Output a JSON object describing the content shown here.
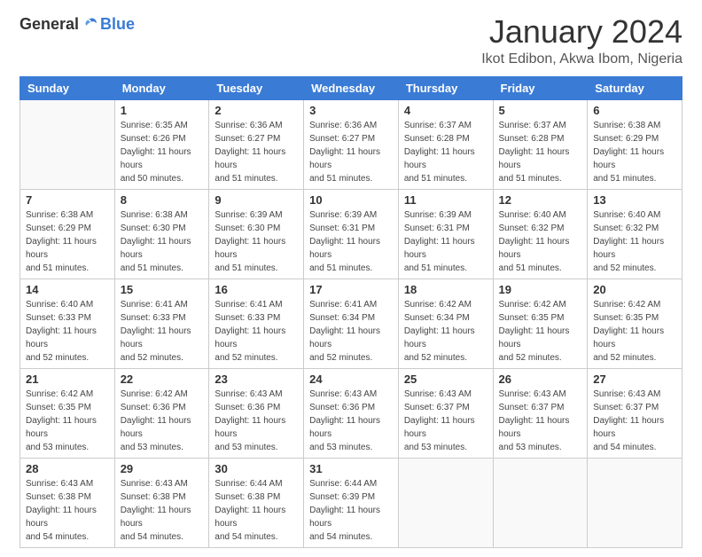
{
  "header": {
    "logo_general": "General",
    "logo_blue": "Blue",
    "month_title": "January 2024",
    "location": "Ikot Edibon, Akwa Ibom, Nigeria"
  },
  "weekdays": [
    "Sunday",
    "Monday",
    "Tuesday",
    "Wednesday",
    "Thursday",
    "Friday",
    "Saturday"
  ],
  "weeks": [
    [
      {
        "day": "",
        "sunrise": "",
        "sunset": "",
        "daylight": ""
      },
      {
        "day": "1",
        "sunrise": "Sunrise: 6:35 AM",
        "sunset": "Sunset: 6:26 PM",
        "daylight": "Daylight: 11 hours and 50 minutes."
      },
      {
        "day": "2",
        "sunrise": "Sunrise: 6:36 AM",
        "sunset": "Sunset: 6:27 PM",
        "daylight": "Daylight: 11 hours and 51 minutes."
      },
      {
        "day": "3",
        "sunrise": "Sunrise: 6:36 AM",
        "sunset": "Sunset: 6:27 PM",
        "daylight": "Daylight: 11 hours and 51 minutes."
      },
      {
        "day": "4",
        "sunrise": "Sunrise: 6:37 AM",
        "sunset": "Sunset: 6:28 PM",
        "daylight": "Daylight: 11 hours and 51 minutes."
      },
      {
        "day": "5",
        "sunrise": "Sunrise: 6:37 AM",
        "sunset": "Sunset: 6:28 PM",
        "daylight": "Daylight: 11 hours and 51 minutes."
      },
      {
        "day": "6",
        "sunrise": "Sunrise: 6:38 AM",
        "sunset": "Sunset: 6:29 PM",
        "daylight": "Daylight: 11 hours and 51 minutes."
      }
    ],
    [
      {
        "day": "7",
        "sunrise": "Sunrise: 6:38 AM",
        "sunset": "Sunset: 6:29 PM",
        "daylight": "Daylight: 11 hours and 51 minutes."
      },
      {
        "day": "8",
        "sunrise": "Sunrise: 6:38 AM",
        "sunset": "Sunset: 6:30 PM",
        "daylight": "Daylight: 11 hours and 51 minutes."
      },
      {
        "day": "9",
        "sunrise": "Sunrise: 6:39 AM",
        "sunset": "Sunset: 6:30 PM",
        "daylight": "Daylight: 11 hours and 51 minutes."
      },
      {
        "day": "10",
        "sunrise": "Sunrise: 6:39 AM",
        "sunset": "Sunset: 6:31 PM",
        "daylight": "Daylight: 11 hours and 51 minutes."
      },
      {
        "day": "11",
        "sunrise": "Sunrise: 6:39 AM",
        "sunset": "Sunset: 6:31 PM",
        "daylight": "Daylight: 11 hours and 51 minutes."
      },
      {
        "day": "12",
        "sunrise": "Sunrise: 6:40 AM",
        "sunset": "Sunset: 6:32 PM",
        "daylight": "Daylight: 11 hours and 51 minutes."
      },
      {
        "day": "13",
        "sunrise": "Sunrise: 6:40 AM",
        "sunset": "Sunset: 6:32 PM",
        "daylight": "Daylight: 11 hours and 52 minutes."
      }
    ],
    [
      {
        "day": "14",
        "sunrise": "Sunrise: 6:40 AM",
        "sunset": "Sunset: 6:33 PM",
        "daylight": "Daylight: 11 hours and 52 minutes."
      },
      {
        "day": "15",
        "sunrise": "Sunrise: 6:41 AM",
        "sunset": "Sunset: 6:33 PM",
        "daylight": "Daylight: 11 hours and 52 minutes."
      },
      {
        "day": "16",
        "sunrise": "Sunrise: 6:41 AM",
        "sunset": "Sunset: 6:33 PM",
        "daylight": "Daylight: 11 hours and 52 minutes."
      },
      {
        "day": "17",
        "sunrise": "Sunrise: 6:41 AM",
        "sunset": "Sunset: 6:34 PM",
        "daylight": "Daylight: 11 hours and 52 minutes."
      },
      {
        "day": "18",
        "sunrise": "Sunrise: 6:42 AM",
        "sunset": "Sunset: 6:34 PM",
        "daylight": "Daylight: 11 hours and 52 minutes."
      },
      {
        "day": "19",
        "sunrise": "Sunrise: 6:42 AM",
        "sunset": "Sunset: 6:35 PM",
        "daylight": "Daylight: 11 hours and 52 minutes."
      },
      {
        "day": "20",
        "sunrise": "Sunrise: 6:42 AM",
        "sunset": "Sunset: 6:35 PM",
        "daylight": "Daylight: 11 hours and 52 minutes."
      }
    ],
    [
      {
        "day": "21",
        "sunrise": "Sunrise: 6:42 AM",
        "sunset": "Sunset: 6:35 PM",
        "daylight": "Daylight: 11 hours and 53 minutes."
      },
      {
        "day": "22",
        "sunrise": "Sunrise: 6:42 AM",
        "sunset": "Sunset: 6:36 PM",
        "daylight": "Daylight: 11 hours and 53 minutes."
      },
      {
        "day": "23",
        "sunrise": "Sunrise: 6:43 AM",
        "sunset": "Sunset: 6:36 PM",
        "daylight": "Daylight: 11 hours and 53 minutes."
      },
      {
        "day": "24",
        "sunrise": "Sunrise: 6:43 AM",
        "sunset": "Sunset: 6:36 PM",
        "daylight": "Daylight: 11 hours and 53 minutes."
      },
      {
        "day": "25",
        "sunrise": "Sunrise: 6:43 AM",
        "sunset": "Sunset: 6:37 PM",
        "daylight": "Daylight: 11 hours and 53 minutes."
      },
      {
        "day": "26",
        "sunrise": "Sunrise: 6:43 AM",
        "sunset": "Sunset: 6:37 PM",
        "daylight": "Daylight: 11 hours and 53 minutes."
      },
      {
        "day": "27",
        "sunrise": "Sunrise: 6:43 AM",
        "sunset": "Sunset: 6:37 PM",
        "daylight": "Daylight: 11 hours and 54 minutes."
      }
    ],
    [
      {
        "day": "28",
        "sunrise": "Sunrise: 6:43 AM",
        "sunset": "Sunset: 6:38 PM",
        "daylight": "Daylight: 11 hours and 54 minutes."
      },
      {
        "day": "29",
        "sunrise": "Sunrise: 6:43 AM",
        "sunset": "Sunset: 6:38 PM",
        "daylight": "Daylight: 11 hours and 54 minutes."
      },
      {
        "day": "30",
        "sunrise": "Sunrise: 6:44 AM",
        "sunset": "Sunset: 6:38 PM",
        "daylight": "Daylight: 11 hours and 54 minutes."
      },
      {
        "day": "31",
        "sunrise": "Sunrise: 6:44 AM",
        "sunset": "Sunset: 6:39 PM",
        "daylight": "Daylight: 11 hours and 54 minutes."
      },
      {
        "day": "",
        "sunrise": "",
        "sunset": "",
        "daylight": ""
      },
      {
        "day": "",
        "sunrise": "",
        "sunset": "",
        "daylight": ""
      },
      {
        "day": "",
        "sunrise": "",
        "sunset": "",
        "daylight": ""
      }
    ]
  ]
}
